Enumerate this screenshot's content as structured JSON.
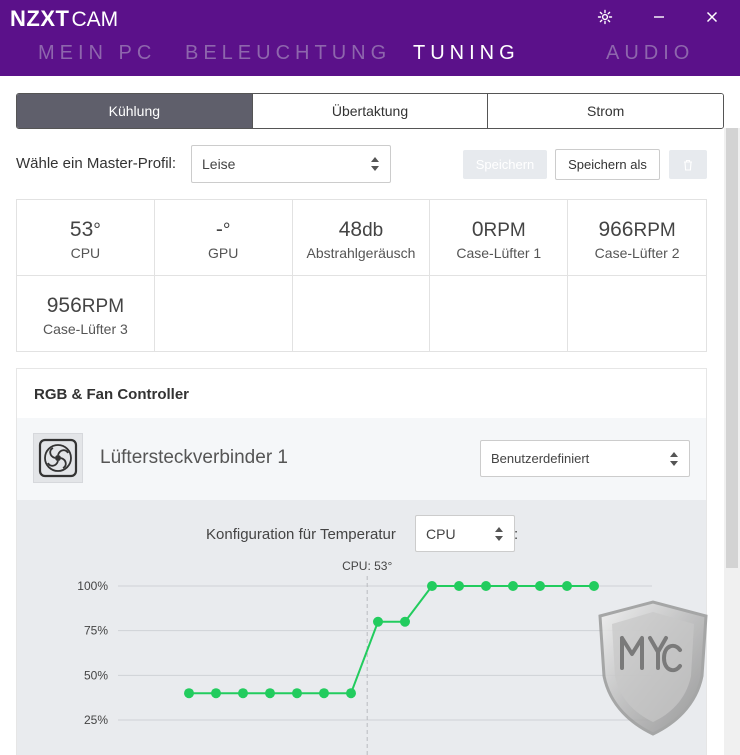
{
  "app": {
    "logo_main": "NZXT",
    "logo_sub": "CAM"
  },
  "nav": {
    "items": [
      "MEIN PC",
      "BELEUCHTUNG",
      "TUNING",
      "AUDIO"
    ],
    "active": "TUNING"
  },
  "subtabs": {
    "items": [
      "Kühlung",
      "Übertaktung",
      "Strom"
    ],
    "active": "Kühlung"
  },
  "profile": {
    "label": "Wähle ein Master-Profil:",
    "selected": "Leise",
    "save_label": "Speichern",
    "save_as_label": "Speichern als"
  },
  "stats": [
    {
      "value": "53",
      "unit": "°",
      "label": "CPU"
    },
    {
      "value": "-",
      "unit": "°",
      "label": "GPU"
    },
    {
      "value": "48",
      "unit": "db",
      "label": "Abstrahlgeräusch"
    },
    {
      "value": "0",
      "unit": "RPM",
      "label": "Case-Lüfter 1"
    },
    {
      "value": "966",
      "unit": "RPM",
      "label": "Case-Lüfter 2"
    },
    {
      "value": "956",
      "unit": "RPM",
      "label": "Case-Lüfter 3"
    }
  ],
  "controller": {
    "title": "RGB & Fan Controller",
    "fan_name": "Lüftersteckverbinder 1",
    "mode_selected": "Benutzerdefiniert",
    "config_label": "Konfiguration für Temperatur",
    "config_colon": ":",
    "temp_source": "CPU"
  },
  "icons": {
    "settings": "gear-icon",
    "minimize": "minimize-icon",
    "close": "close-icon",
    "delete": "trash-icon",
    "fan": "fan-icon",
    "select_arrows": "sort-arrows-icon"
  },
  "colors": {
    "header": "#5b118a",
    "curve": "#22cc5e",
    "active_tab": "#5f5f6b"
  },
  "chart_data": {
    "type": "line",
    "x": [
      1,
      2,
      3,
      4,
      5,
      6,
      7,
      8,
      9,
      10,
      11,
      12,
      13,
      14,
      15,
      16
    ],
    "values": [
      40,
      40,
      40,
      40,
      40,
      40,
      40,
      80,
      80,
      100,
      100,
      100,
      100,
      100,
      100,
      100
    ],
    "yticks": [
      "100%",
      "75%",
      "50%",
      "25%"
    ],
    "ytick_values": [
      100,
      75,
      50,
      25
    ],
    "marker_label": "CPU: 53°",
    "marker_x": 7.6,
    "ylim": [
      0,
      100
    ],
    "grid": true
  }
}
